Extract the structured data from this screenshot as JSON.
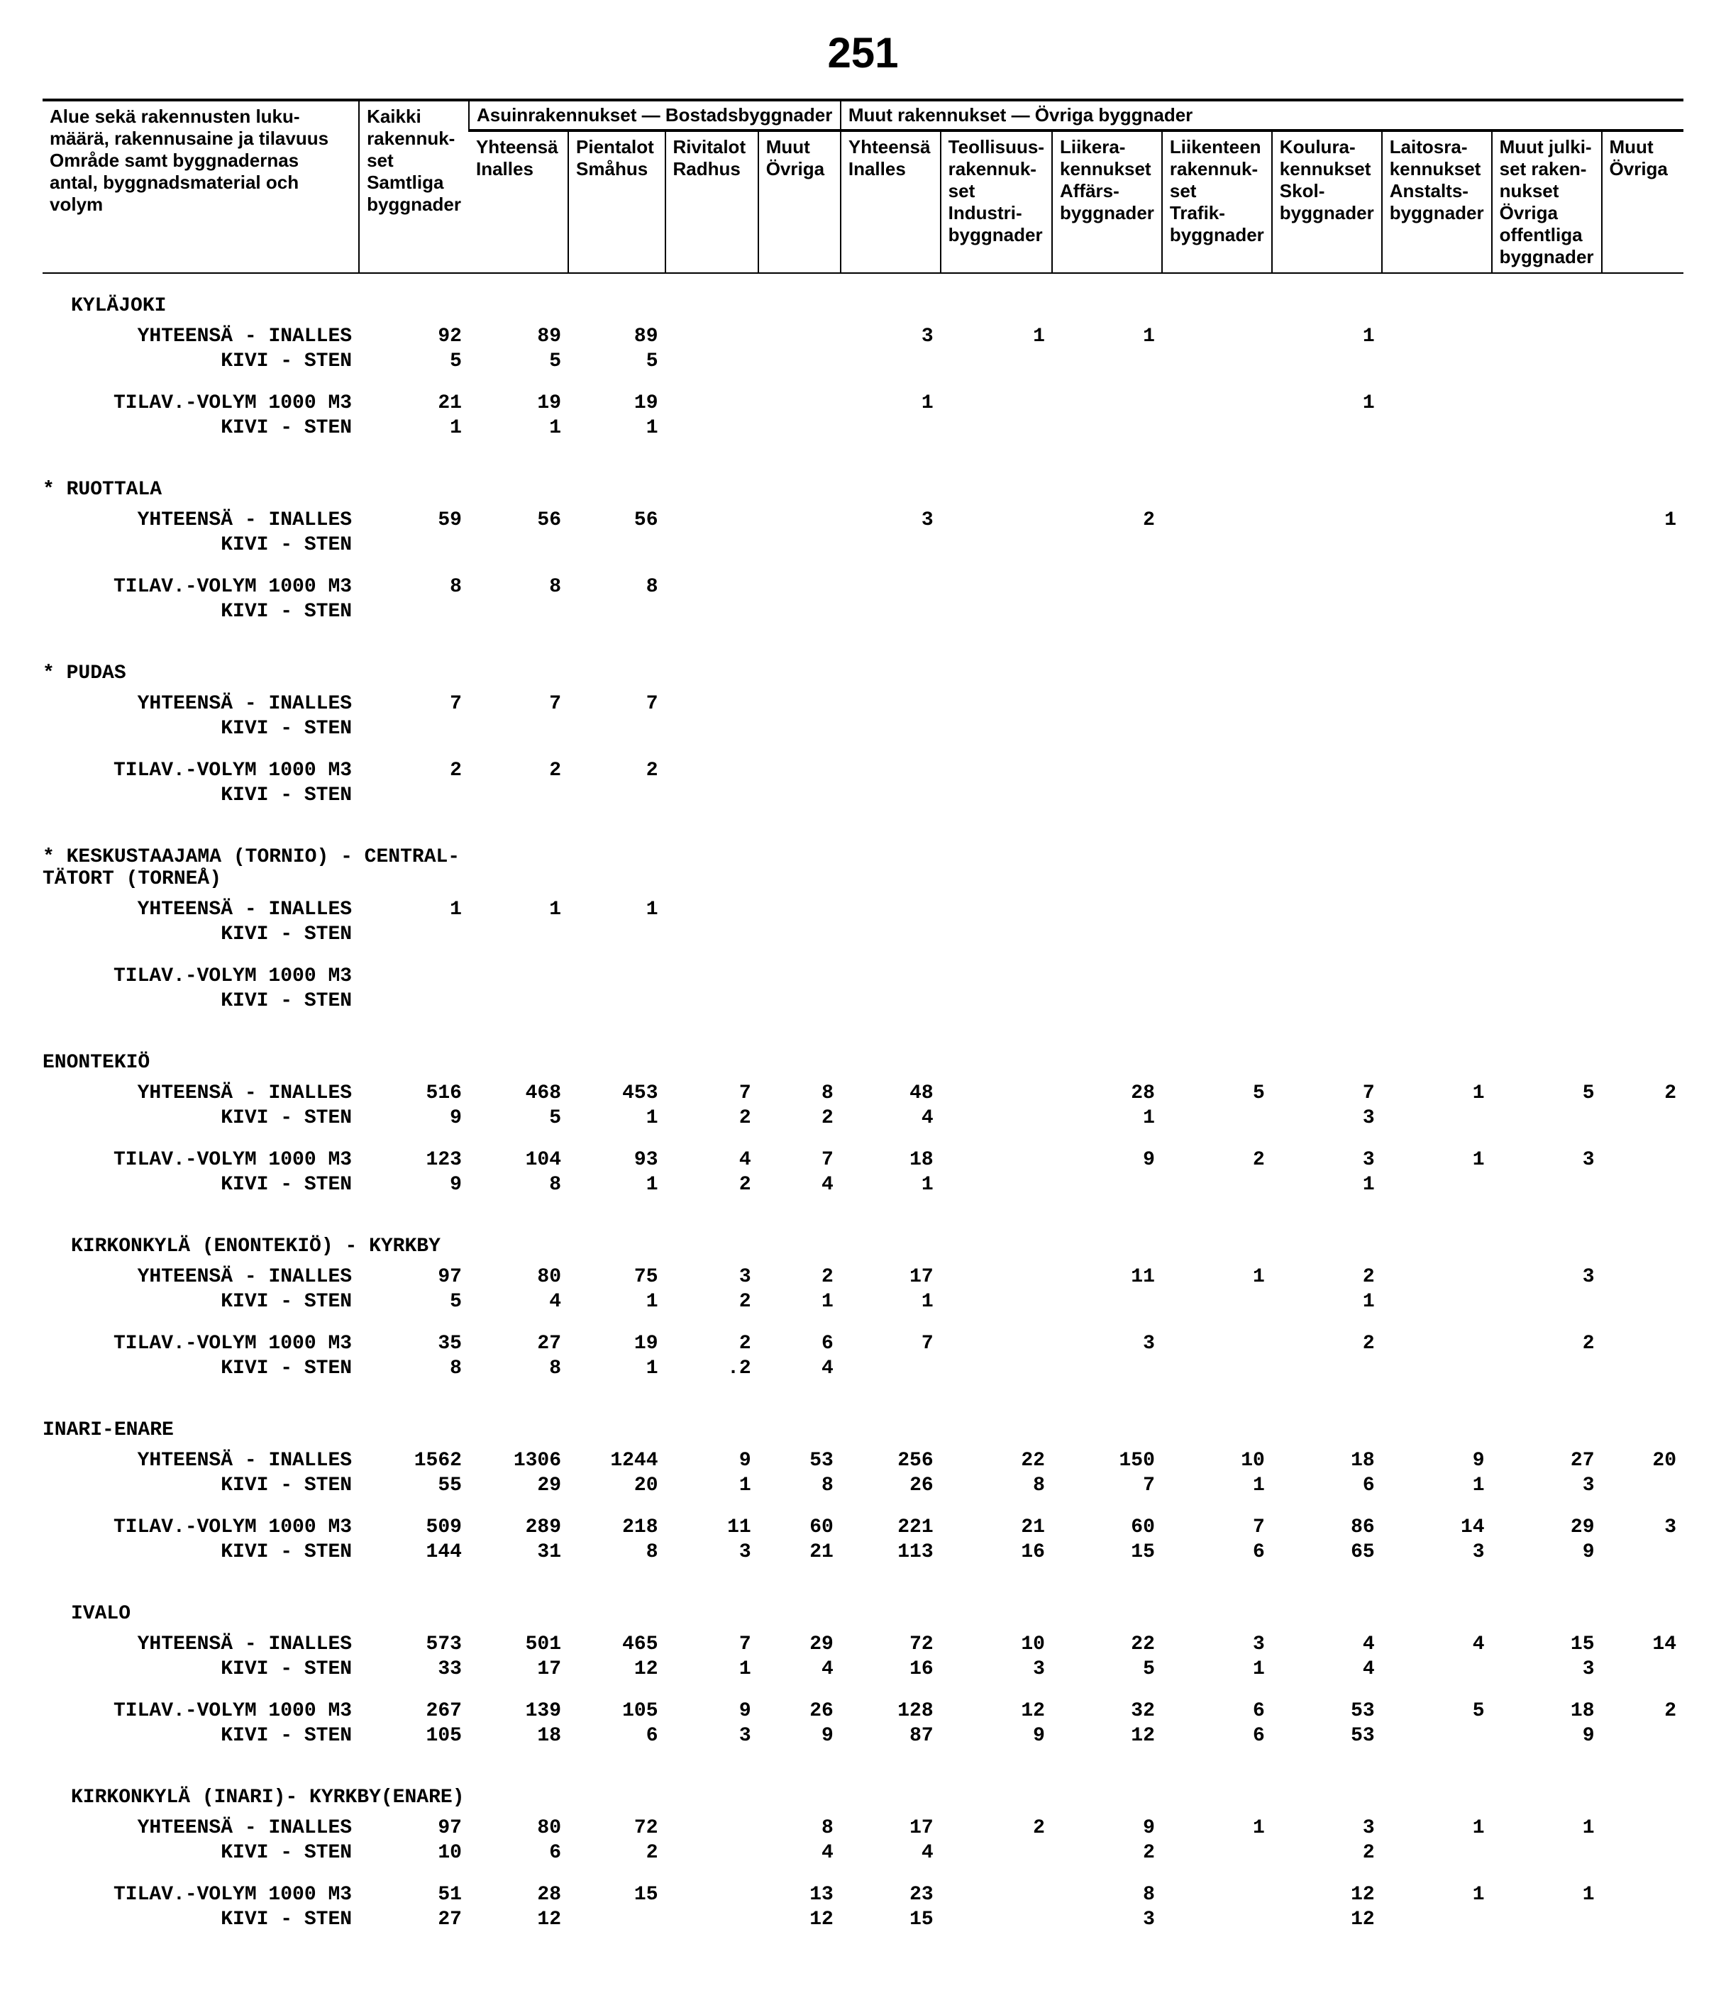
{
  "page_number": "251",
  "header": {
    "col1": "Alue sekä rakennusten luku-määrä, rakennusaine ja tilavuus\nOmråde samt byggnadernas antal, byggnadsmaterial och volym",
    "col2": "Kaikki rakennuk-set\nSamtliga byggnader",
    "group1": "Asuinrakennukset — Bostadsbyggnader",
    "g1c1": "Yhteensä\nInalles",
    "g1c2": "Pientalot\nSmåhus",
    "g1c3": "Rivitalot\nRadhus",
    "g1c4": "Muut\nÖvriga",
    "group2": "Muut rakennukset — Övriga byggnader",
    "g2c1": "Yhteensä\nInalles",
    "g2c2": "Teollisuus-rakennuk-set\nIndustri-byggnader",
    "g2c3": "Liikera-kennukset\nAffärs-byggnader",
    "g2c4": "Liikenteen rakennuk-set\nTrafik-byggnader",
    "g2c5": "Koulura-kennukset\nSkol-byggnader",
    "g2c6": "Laitosra-kennukset\nAnstalts-byggnader",
    "g2c7": "Muut julki-set raken-nukset\nÖvriga offentliga byggnader",
    "g2c8": "Muut\nÖvriga"
  },
  "labels": {
    "yht": "YHTEENSÄ - INALLES",
    "kivi": "KIVI - STEN",
    "til": "TILAV.-VOLYM 1000 M3"
  },
  "sections": [
    {
      "title": "KYLÄJOKI",
      "indent": "sub",
      "blocks": [
        {
          "kind": "pair",
          "r1": [
            "92",
            "89",
            "89",
            "",
            "",
            "3",
            "1",
            "1",
            "",
            "1",
            "",
            "",
            ""
          ],
          "r2": [
            "5",
            "5",
            "5",
            "",
            "",
            "",
            "",
            "",
            "",
            "",
            "",
            "",
            ""
          ]
        },
        {
          "kind": "til",
          "r1": [
            "21",
            "19",
            "19",
            "",
            "",
            "1",
            "",
            "",
            "",
            "1",
            "",
            "",
            ""
          ],
          "r2": [
            "1",
            "1",
            "1",
            "",
            "",
            "",
            "",
            "",
            "",
            "",
            "",
            "",
            ""
          ]
        }
      ]
    },
    {
      "title": "* RUOTTALA",
      "indent": "top",
      "blocks": [
        {
          "kind": "pair",
          "r1": [
            "59",
            "56",
            "56",
            "",
            "",
            "3",
            "",
            "2",
            "",
            "",
            "",
            "",
            "1"
          ],
          "r2": [
            "",
            "",
            "",
            "",
            "",
            "",
            "",
            "",
            "",
            "",
            "",
            "",
            ""
          ]
        },
        {
          "kind": "til",
          "r1": [
            "8",
            "8",
            "8",
            "",
            "",
            "",
            "",
            "",
            "",
            "",
            "",
            "",
            ""
          ],
          "r2": [
            "",
            "",
            "",
            "",
            "",
            "",
            "",
            "",
            "",
            "",
            "",
            "",
            ""
          ]
        }
      ]
    },
    {
      "title": "* PUDAS",
      "indent": "top",
      "blocks": [
        {
          "kind": "pair",
          "r1": [
            "7",
            "7",
            "7",
            "",
            "",
            "",
            "",
            "",
            "",
            "",
            "",
            "",
            ""
          ],
          "r2": [
            "",
            "",
            "",
            "",
            "",
            "",
            "",
            "",
            "",
            "",
            "",
            "",
            ""
          ]
        },
        {
          "kind": "til",
          "r1": [
            "2",
            "2",
            "2",
            "",
            "",
            "",
            "",
            "",
            "",
            "",
            "",
            "",
            ""
          ],
          "r2": [
            "",
            "",
            "",
            "",
            "",
            "",
            "",
            "",
            "",
            "",
            "",
            "",
            ""
          ]
        }
      ]
    },
    {
      "title": "* KESKUSTAAJAMA (TORNIO) - CENTRAL-\n  TÄTORT (TORNEÅ)",
      "indent": "top",
      "blocks": [
        {
          "kind": "pair",
          "r1": [
            "1",
            "1",
            "1",
            "",
            "",
            "",
            "",
            "",
            "",
            "",
            "",
            "",
            ""
          ],
          "r2": [
            "",
            "",
            "",
            "",
            "",
            "",
            "",
            "",
            "",
            "",
            "",
            "",
            ""
          ]
        },
        {
          "kind": "til",
          "r1": [
            "",
            "",
            "",
            "",
            "",
            "",
            "",
            "",
            "",
            "",
            "",
            "",
            ""
          ],
          "r2": [
            "",
            "",
            "",
            "",
            "",
            "",
            "",
            "",
            "",
            "",
            "",
            "",
            ""
          ]
        }
      ]
    },
    {
      "title": "ENONTEKIÖ",
      "indent": "top",
      "blocks": [
        {
          "kind": "pair",
          "r1": [
            "516",
            "468",
            "453",
            "7",
            "8",
            "48",
            "",
            "28",
            "5",
            "7",
            "1",
            "5",
            "2"
          ],
          "r2": [
            "9",
            "5",
            "1",
            "2",
            "2",
            "4",
            "",
            "1",
            "",
            "3",
            "",
            "",
            ""
          ]
        },
        {
          "kind": "til",
          "r1": [
            "123",
            "104",
            "93",
            "4",
            "7",
            "18",
            "",
            "9",
            "2",
            "3",
            "1",
            "3",
            ""
          ],
          "r2": [
            "9",
            "8",
            "1",
            "2",
            "4",
            "1",
            "",
            "",
            "",
            "1",
            "",
            "",
            ""
          ]
        }
      ]
    },
    {
      "title": "KIRKONKYLÄ (ENONTEKIÖ) - KYRKBY",
      "indent": "sub",
      "blocks": [
        {
          "kind": "pair",
          "r1": [
            "97",
            "80",
            "75",
            "3",
            "2",
            "17",
            "",
            "11",
            "1",
            "2",
            "",
            "3",
            ""
          ],
          "r2": [
            "5",
            "4",
            "1",
            "2",
            "1",
            "1",
            "",
            "",
            "",
            "1",
            "",
            "",
            ""
          ]
        },
        {
          "kind": "til",
          "r1": [
            "35",
            "27",
            "19",
            "2",
            "6",
            "7",
            "",
            "3",
            "",
            "2",
            "",
            "2",
            ""
          ],
          "r2": [
            "8",
            "8",
            "1",
            ".2",
            "4",
            "",
            "",
            "",
            "",
            "",
            "",
            "",
            ""
          ]
        }
      ]
    },
    {
      "title": "INARI-ENARE",
      "indent": "top",
      "blocks": [
        {
          "kind": "pair",
          "r1": [
            "1562",
            "1306",
            "1244",
            "9",
            "53",
            "256",
            "22",
            "150",
            "10",
            "18",
            "9",
            "27",
            "20"
          ],
          "r2": [
            "55",
            "29",
            "20",
            "1",
            "8",
            "26",
            "8",
            "7",
            "1",
            "6",
            "1",
            "3",
            ""
          ]
        },
        {
          "kind": "til",
          "r1": [
            "509",
            "289",
            "218",
            "11",
            "60",
            "221",
            "21",
            "60",
            "7",
            "86",
            "14",
            "29",
            "3"
          ],
          "r2": [
            "144",
            "31",
            "8",
            "3",
            "21",
            "113",
            "16",
            "15",
            "6",
            "65",
            "3",
            "9",
            ""
          ]
        }
      ]
    },
    {
      "title": "IVALO",
      "indent": "sub",
      "blocks": [
        {
          "kind": "pair",
          "r1": [
            "573",
            "501",
            "465",
            "7",
            "29",
            "72",
            "10",
            "22",
            "3",
            "4",
            "4",
            "15",
            "14"
          ],
          "r2": [
            "33",
            "17",
            "12",
            "1",
            "4",
            "16",
            "3",
            "5",
            "1",
            "4",
            "",
            "3",
            ""
          ]
        },
        {
          "kind": "til",
          "r1": [
            "267",
            "139",
            "105",
            "9",
            "26",
            "128",
            "12",
            "32",
            "6",
            "53",
            "5",
            "18",
            "2"
          ],
          "r2": [
            "105",
            "18",
            "6",
            "3",
            "9",
            "87",
            "9",
            "12",
            "6",
            "53",
            "",
            "9",
            ""
          ]
        }
      ]
    },
    {
      "title": "KIRKONKYLÄ (INARI)- KYRKBY(ENARE)",
      "indent": "sub",
      "blocks": [
        {
          "kind": "pair",
          "r1": [
            "97",
            "80",
            "72",
            "",
            "8",
            "17",
            "2",
            "9",
            "1",
            "3",
            "1",
            "1",
            ""
          ],
          "r2": [
            "10",
            "6",
            "2",
            "",
            "4",
            "4",
            "",
            "2",
            "",
            "2",
            "",
            "",
            ""
          ]
        },
        {
          "kind": "til",
          "r1": [
            "51",
            "28",
            "15",
            "",
            "13",
            "23",
            "",
            "8",
            "",
            "12",
            "1",
            "1",
            ""
          ],
          "r2": [
            "27",
            "12",
            "",
            "",
            "12",
            "15",
            "",
            "3",
            "",
            "12",
            "",
            "",
            ""
          ]
        }
      ]
    }
  ]
}
